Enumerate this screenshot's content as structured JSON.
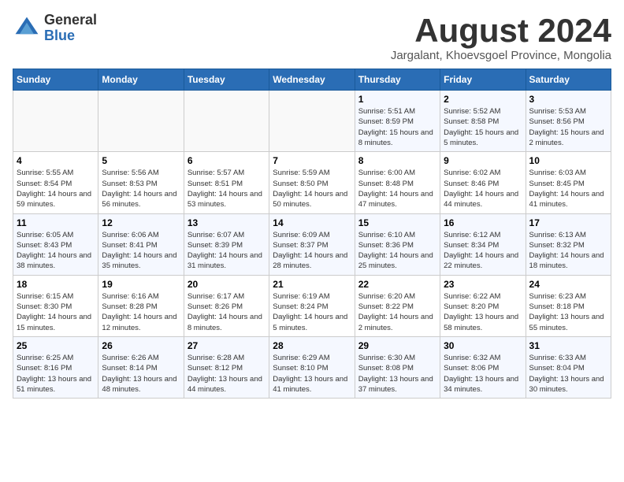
{
  "header": {
    "logo_general": "General",
    "logo_blue": "Blue",
    "month_title": "August 2024",
    "subtitle": "Jargalant, Khoevsgoel Province, Mongolia"
  },
  "weekdays": [
    "Sunday",
    "Monday",
    "Tuesday",
    "Wednesday",
    "Thursday",
    "Friday",
    "Saturday"
  ],
  "weeks": [
    [
      {
        "day": "",
        "info": ""
      },
      {
        "day": "",
        "info": ""
      },
      {
        "day": "",
        "info": ""
      },
      {
        "day": "",
        "info": ""
      },
      {
        "day": "1",
        "info": "Sunrise: 5:51 AM\nSunset: 8:59 PM\nDaylight: 15 hours\nand 8 minutes."
      },
      {
        "day": "2",
        "info": "Sunrise: 5:52 AM\nSunset: 8:58 PM\nDaylight: 15 hours\nand 5 minutes."
      },
      {
        "day": "3",
        "info": "Sunrise: 5:53 AM\nSunset: 8:56 PM\nDaylight: 15 hours\nand 2 minutes."
      }
    ],
    [
      {
        "day": "4",
        "info": "Sunrise: 5:55 AM\nSunset: 8:54 PM\nDaylight: 14 hours\nand 59 minutes."
      },
      {
        "day": "5",
        "info": "Sunrise: 5:56 AM\nSunset: 8:53 PM\nDaylight: 14 hours\nand 56 minutes."
      },
      {
        "day": "6",
        "info": "Sunrise: 5:57 AM\nSunset: 8:51 PM\nDaylight: 14 hours\nand 53 minutes."
      },
      {
        "day": "7",
        "info": "Sunrise: 5:59 AM\nSunset: 8:50 PM\nDaylight: 14 hours\nand 50 minutes."
      },
      {
        "day": "8",
        "info": "Sunrise: 6:00 AM\nSunset: 8:48 PM\nDaylight: 14 hours\nand 47 minutes."
      },
      {
        "day": "9",
        "info": "Sunrise: 6:02 AM\nSunset: 8:46 PM\nDaylight: 14 hours\nand 44 minutes."
      },
      {
        "day": "10",
        "info": "Sunrise: 6:03 AM\nSunset: 8:45 PM\nDaylight: 14 hours\nand 41 minutes."
      }
    ],
    [
      {
        "day": "11",
        "info": "Sunrise: 6:05 AM\nSunset: 8:43 PM\nDaylight: 14 hours\nand 38 minutes."
      },
      {
        "day": "12",
        "info": "Sunrise: 6:06 AM\nSunset: 8:41 PM\nDaylight: 14 hours\nand 35 minutes."
      },
      {
        "day": "13",
        "info": "Sunrise: 6:07 AM\nSunset: 8:39 PM\nDaylight: 14 hours\nand 31 minutes."
      },
      {
        "day": "14",
        "info": "Sunrise: 6:09 AM\nSunset: 8:37 PM\nDaylight: 14 hours\nand 28 minutes."
      },
      {
        "day": "15",
        "info": "Sunrise: 6:10 AM\nSunset: 8:36 PM\nDaylight: 14 hours\nand 25 minutes."
      },
      {
        "day": "16",
        "info": "Sunrise: 6:12 AM\nSunset: 8:34 PM\nDaylight: 14 hours\nand 22 minutes."
      },
      {
        "day": "17",
        "info": "Sunrise: 6:13 AM\nSunset: 8:32 PM\nDaylight: 14 hours\nand 18 minutes."
      }
    ],
    [
      {
        "day": "18",
        "info": "Sunrise: 6:15 AM\nSunset: 8:30 PM\nDaylight: 14 hours\nand 15 minutes."
      },
      {
        "day": "19",
        "info": "Sunrise: 6:16 AM\nSunset: 8:28 PM\nDaylight: 14 hours\nand 12 minutes."
      },
      {
        "day": "20",
        "info": "Sunrise: 6:17 AM\nSunset: 8:26 PM\nDaylight: 14 hours\nand 8 minutes."
      },
      {
        "day": "21",
        "info": "Sunrise: 6:19 AM\nSunset: 8:24 PM\nDaylight: 14 hours\nand 5 minutes."
      },
      {
        "day": "22",
        "info": "Sunrise: 6:20 AM\nSunset: 8:22 PM\nDaylight: 14 hours\nand 2 minutes."
      },
      {
        "day": "23",
        "info": "Sunrise: 6:22 AM\nSunset: 8:20 PM\nDaylight: 13 hours\nand 58 minutes."
      },
      {
        "day": "24",
        "info": "Sunrise: 6:23 AM\nSunset: 8:18 PM\nDaylight: 13 hours\nand 55 minutes."
      }
    ],
    [
      {
        "day": "25",
        "info": "Sunrise: 6:25 AM\nSunset: 8:16 PM\nDaylight: 13 hours\nand 51 minutes."
      },
      {
        "day": "26",
        "info": "Sunrise: 6:26 AM\nSunset: 8:14 PM\nDaylight: 13 hours\nand 48 minutes."
      },
      {
        "day": "27",
        "info": "Sunrise: 6:28 AM\nSunset: 8:12 PM\nDaylight: 13 hours\nand 44 minutes."
      },
      {
        "day": "28",
        "info": "Sunrise: 6:29 AM\nSunset: 8:10 PM\nDaylight: 13 hours\nand 41 minutes."
      },
      {
        "day": "29",
        "info": "Sunrise: 6:30 AM\nSunset: 8:08 PM\nDaylight: 13 hours\nand 37 minutes."
      },
      {
        "day": "30",
        "info": "Sunrise: 6:32 AM\nSunset: 8:06 PM\nDaylight: 13 hours\nand 34 minutes."
      },
      {
        "day": "31",
        "info": "Sunrise: 6:33 AM\nSunset: 8:04 PM\nDaylight: 13 hours\nand 30 minutes."
      }
    ]
  ]
}
